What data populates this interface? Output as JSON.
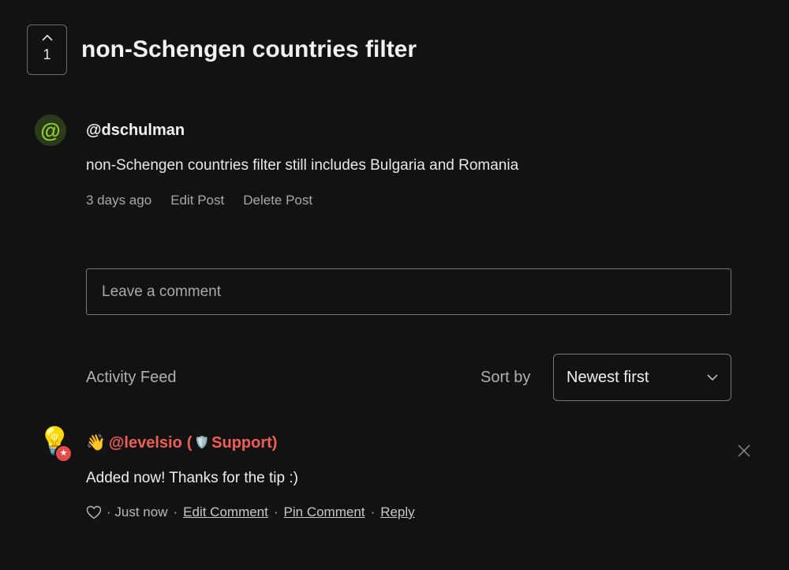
{
  "post": {
    "vote_count": "1",
    "title": "non-Schengen countries filter",
    "author_avatar_glyph": "@",
    "author": "@dschulman",
    "body": "non-Schengen countries filter still includes Bulgaria and Romania",
    "time": "3 days ago",
    "edit_label": "Edit Post",
    "delete_label": "Delete Post"
  },
  "comment_input": {
    "placeholder": "Leave a comment"
  },
  "feed": {
    "title": "Activity Feed",
    "sort_label": "Sort by",
    "sort_value": "Newest first"
  },
  "comment": {
    "wave": "👋",
    "author": "@levelsio",
    "role_open": "(",
    "shield": "🛡️",
    "role": "Support)",
    "body": "Added now! Thanks for the tip :)",
    "time": "· Just now",
    "edit_label": "Edit Comment",
    "pin_label": "Pin Comment",
    "reply_label": "Reply",
    "separator": "·"
  },
  "colors": {
    "background": "#121212",
    "avatar_green": "#8fcf33",
    "support_red": "#ef5f54"
  },
  "icons": {
    "vote": "chevron-up-icon",
    "sort": "chevron-down-icon",
    "close": "close-icon",
    "like": "heart-icon",
    "comment_avatar": "lightbulb-icon",
    "badge": "star-icon"
  }
}
